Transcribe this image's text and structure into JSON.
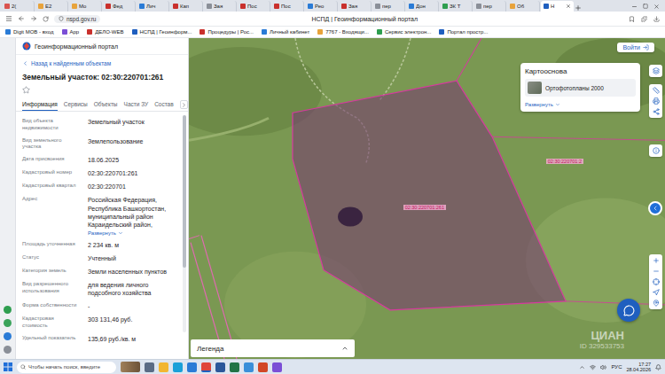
{
  "browser": {
    "tabs": [
      {
        "label": "2(",
        "selected": false,
        "color": "#d9534f"
      },
      {
        "label": "Е2",
        "selected": false,
        "color": "#e8a33b"
      },
      {
        "label": "Мо",
        "selected": false,
        "color": "#e8a33b"
      },
      {
        "label": "Фед",
        "selected": false,
        "color": "#c9302c"
      },
      {
        "label": "Лич",
        "selected": false,
        "color": "#2a7bd6"
      },
      {
        "label": "Кап",
        "selected": false,
        "color": "#c9302c"
      },
      {
        "label": "Зая",
        "selected": false,
        "color": "#8a8f98"
      },
      {
        "label": "Пос",
        "selected": false,
        "color": "#c9302c"
      },
      {
        "label": "Пос",
        "selected": false,
        "color": "#c9302c"
      },
      {
        "label": "Рео",
        "selected": false,
        "color": "#2a7bd6"
      },
      {
        "label": "Зая",
        "selected": false,
        "color": "#c9302c"
      },
      {
        "label": "пер",
        "selected": false,
        "color": "#8a8f98"
      },
      {
        "label": "Дон",
        "selected": false,
        "color": "#2a7bd6"
      },
      {
        "label": "ЗК Т",
        "selected": false,
        "color": "#2e9e4f"
      },
      {
        "label": "пер",
        "selected": false,
        "color": "#8a8f98"
      },
      {
        "label": "Об",
        "selected": false,
        "color": "#e8a33b"
      },
      {
        "label": "Н",
        "selected": true,
        "color": "#1f5fbf"
      }
    ],
    "address": "nspd.gov.ru",
    "page_title": "НСПД | Геоинформационный портал",
    "bookmarks": [
      {
        "label": "Digit МОВ - вход",
        "color": "#2a7bd6"
      },
      {
        "label": "App",
        "color": "#7b4fd6"
      },
      {
        "label": "ДЕЛО-WEB",
        "color": "#c9302c"
      },
      {
        "label": "НСПД | Геоинформ...",
        "color": "#1f5fbf"
      },
      {
        "label": "Процедуры | Рос...",
        "color": "#c9302c"
      },
      {
        "label": "Личный кабинет",
        "color": "#2a7bd6"
      },
      {
        "label": "7767 - Входящи...",
        "color": "#e8a33b"
      },
      {
        "label": "Сервис электрон...",
        "color": "#2e9e4f"
      },
      {
        "label": "Портал простр...",
        "color": "#1f5fbf"
      }
    ]
  },
  "portal": {
    "logo_text": "Геоинформационный портал",
    "back": "Назад к найденным объектам",
    "title": "Земельный участок: 02:30:220701:261",
    "favorite": false,
    "tabs": [
      {
        "label": "Информация",
        "selected": true
      },
      {
        "label": "Сервисы",
        "selected": false
      },
      {
        "label": "Объекты",
        "selected": false
      },
      {
        "label": "Части ЗУ",
        "selected": false
      },
      {
        "label": "Состав",
        "selected": false
      }
    ],
    "fields": [
      {
        "label": "Вид объекта недвижимости",
        "value": "Земельный участок",
        "expand": ""
      },
      {
        "label": "Вид земельного участка",
        "value": "Землепользование",
        "expand": ""
      },
      {
        "label": "Дата присвоения",
        "value": "18.06.2025",
        "expand": ""
      },
      {
        "label": "Кадастровый номер",
        "value": "02:30:220701:261",
        "expand": ""
      },
      {
        "label": "Кадастровый квартал",
        "value": "02:30:220701",
        "expand": ""
      },
      {
        "label": "Адрес",
        "value": "Российская Федерация, Республика Башкортостан, муниципальный район Караидельский район,",
        "expand": "Развернуть"
      },
      {
        "label": "Площадь уточненная",
        "value": "2 234 кв. м",
        "expand": ""
      },
      {
        "label": "Статус",
        "value": "Учтенный",
        "expand": ""
      },
      {
        "label": "Категория земель",
        "value": "Земли населенных пунктов",
        "expand": ""
      },
      {
        "label": "Вид разрешенного использования",
        "value": "для ведения личного подсобного хозяйства",
        "expand": ""
      },
      {
        "label": "Форма собственности",
        "value": "-",
        "expand": ""
      },
      {
        "label": "Кадастровая стоимость",
        "value": "303 131,46 руб.",
        "expand": ""
      },
      {
        "label": "Удельный показатель",
        "value": "135,69 руб./кв. м",
        "expand": ""
      }
    ]
  },
  "map": {
    "login": "Войти",
    "basemap": {
      "title": "Картооснова",
      "layer": "Ортофотопланы 2000",
      "expand": "Развернуть"
    },
    "parcel_label": "02:30:220701:261",
    "neighbour_label": "02:30:220701:2",
    "legend": "Легенда",
    "watermark": {
      "brand": "ЦИАН",
      "id": "ID 329533753"
    }
  },
  "taskbar": {
    "search_placeholder": "Чтобы начать поиск, введите",
    "apps": [
      {
        "color": "#5a6b85",
        "running": false
      },
      {
        "color": "#f2b632",
        "running": false
      },
      {
        "color": "#1aa0d8",
        "running": false
      },
      {
        "color": "#2a7bd6",
        "running": false
      },
      {
        "color": "#e0453a",
        "running": true
      },
      {
        "color": "#2b579a",
        "running": false
      },
      {
        "color": "#217346",
        "running": false
      },
      {
        "color": "#3a8fd9",
        "running": false
      },
      {
        "color": "#d24726",
        "running": false
      },
      {
        "color": "#7b4fd6",
        "running": false
      }
    ],
    "lang": "РУС",
    "time": "17:27",
    "date": "28.04.2026"
  }
}
